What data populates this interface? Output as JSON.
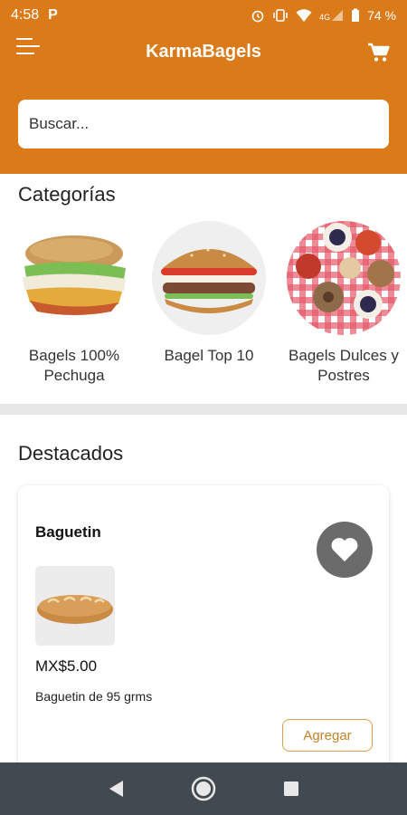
{
  "status_bar": {
    "time": "4:58",
    "app_icon": "P",
    "network": "4G",
    "battery": "74 %"
  },
  "app_bar": {
    "title": "KarmaBagels"
  },
  "search": {
    "placeholder": "Buscar..."
  },
  "categories": {
    "title": "Categorías",
    "items": [
      {
        "label": "Bagels 100% Pechuga"
      },
      {
        "label": "Bagel Top 10"
      },
      {
        "label": "Bagels Dulces y Postres"
      }
    ]
  },
  "featured": {
    "title": "Destacados",
    "product": {
      "name": "Baguetin",
      "price": "MX$5.00",
      "description": "Baguetin de 95 grms",
      "add_label": "Agregar"
    }
  },
  "colors": {
    "primary": "#db7a19",
    "nav_bar": "#414a51",
    "accent_button": "#c0812a"
  },
  "icons": [
    "menu-icon",
    "cart-icon",
    "heart-icon",
    "back-icon",
    "home-icon",
    "recents-icon"
  ]
}
